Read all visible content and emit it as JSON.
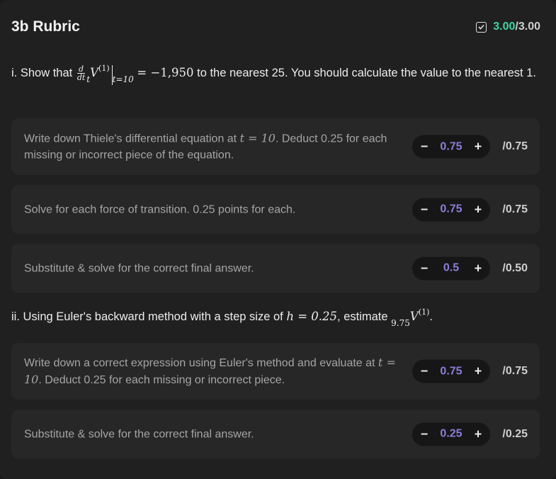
{
  "rubric": {
    "title": "3b Rubric",
    "score_earned": "3.00",
    "score_separator": "/",
    "score_max": "3.00",
    "icon": "checkbox-icon",
    "accent_color": "#3ed6a0"
  },
  "q1": {
    "prefix": "i. Show that",
    "math_value": "= −1,950",
    "suffix": "to the nearest 25. You should calculate the value to the nearest 1.",
    "frac_num": "d",
    "frac_den": "dt",
    "pre_sub": "t",
    "V": "V",
    "sup": "(1)",
    "eval_sub": "t=10"
  },
  "q2": {
    "prefix": "ii. Using Euler's backward method with a step size of",
    "h_eq": "h = 0.25",
    "middle": ", estimate",
    "pre_sub": "9.75",
    "V": "V",
    "sup": "(1)",
    "suffix": "."
  },
  "items": [
    {
      "text_a": "Write down Thiele's differential equation at",
      "math": "t = 10",
      "text_b": ". Deduct 0.25 for each missing or incorrect piece of the equation.",
      "value": "0.75",
      "max": "/0.75"
    },
    {
      "text_a": "Solve for each force of transition. 0.25 points for each.",
      "value": "0.75",
      "max": "/0.75"
    },
    {
      "text_a": "Substitute & solve for the correct final answer.",
      "value": "0.5",
      "max": "/0.50"
    },
    {
      "text_a": "Write down a correct expression using Euler's method and evaluate at",
      "math": "t = 10",
      "text_b": ". Deduct 0.25 for each missing or incorrect piece.",
      "value": "0.75",
      "max": "/0.75"
    },
    {
      "text_a": "Substitute & solve for the correct final answer.",
      "value": "0.25",
      "max": "/0.25"
    }
  ],
  "stepper": {
    "minus": "−",
    "plus": "+"
  }
}
